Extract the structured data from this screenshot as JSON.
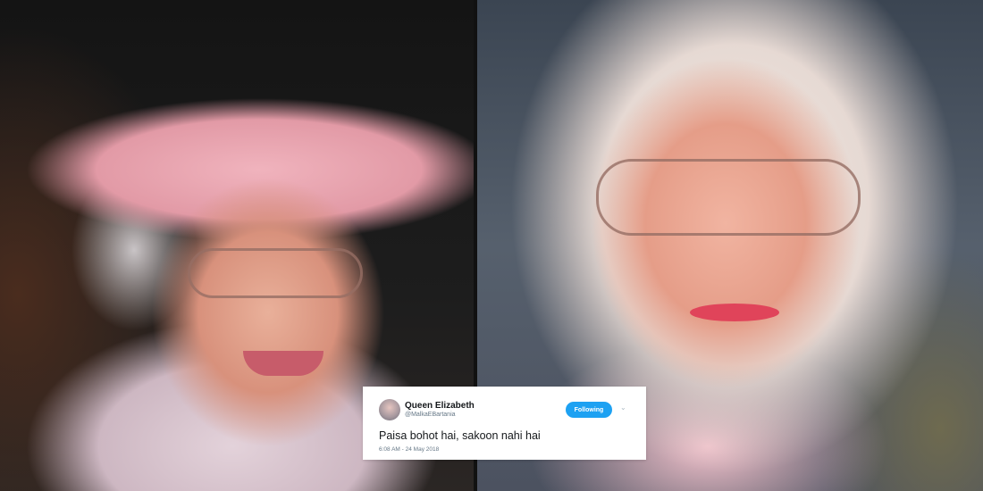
{
  "tweet": {
    "name": "Queen Elizabeth",
    "handle": "@MalkaEBartania",
    "follow_label": "Following",
    "text": "Paisa bohot hai, sakoon nahi hai",
    "timestamp": "6:08 AM - 24 May 2018",
    "menu_icon": "chevron-down-icon"
  },
  "colors": {
    "follow_button": "#1da1f2",
    "card_background": "#ffffff",
    "text_primary": "#14171a",
    "text_secondary": "#657786"
  }
}
